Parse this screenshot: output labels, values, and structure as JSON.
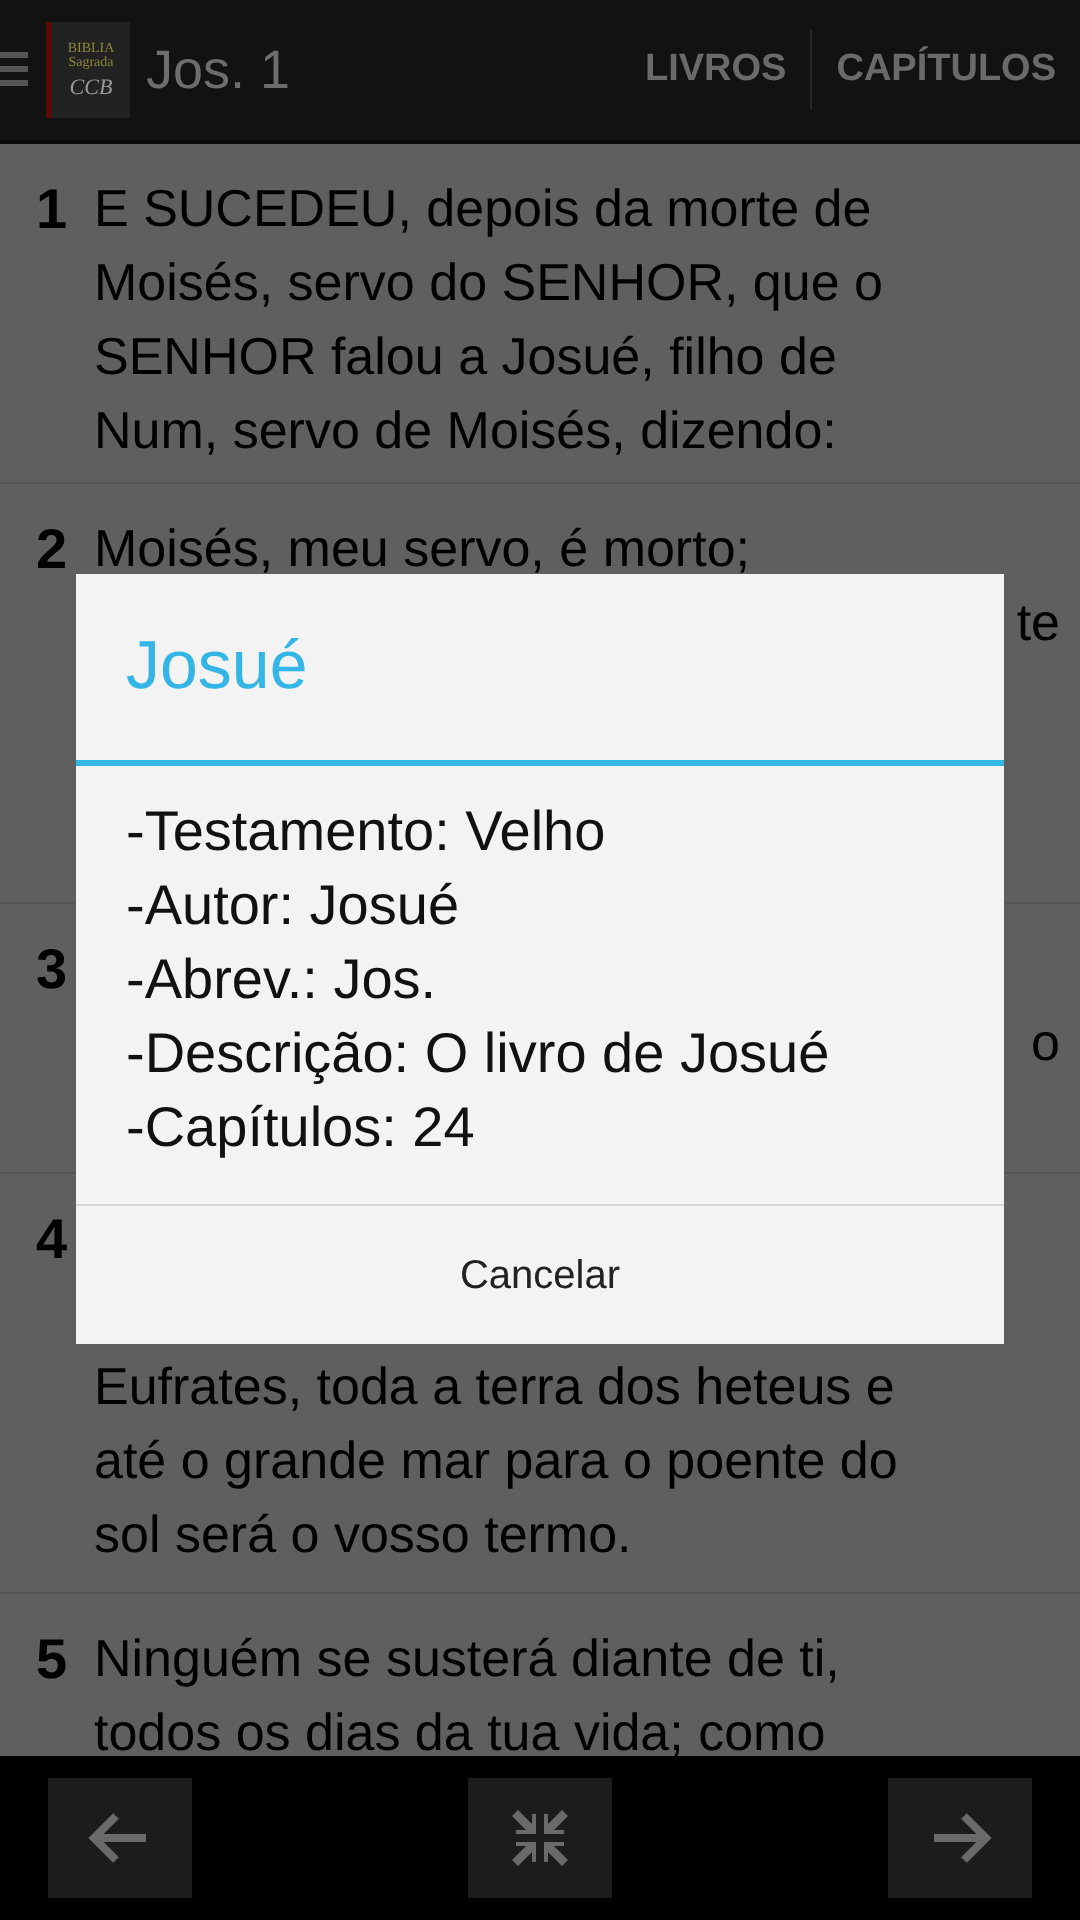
{
  "app_bar": {
    "logo": {
      "line_1": "BIBLIA",
      "line_2": "Sagrada",
      "line_3": "CCB"
    },
    "title": "Jos. 1",
    "actions": [
      "LIVROS",
      "CAPÍTULOS"
    ]
  },
  "verses": [
    {
      "number": "1",
      "lines": [
        {
          "kind": "text",
          "text": "E SUCEDEU, depois da morte de"
        },
        {
          "kind": "text",
          "text": "Moisés, servo do SENHOR, que o"
        },
        {
          "kind": "text",
          "text": "SENHOR falou a Josué, filho de"
        },
        {
          "kind": "text",
          "text": "Num, servo de Moisés, dizendo:"
        }
      ]
    },
    {
      "number": "2",
      "lines": [
        {
          "kind": "text",
          "text": "Moisés, meu servo, é morto;"
        },
        {
          "kind": "end",
          "text": "te"
        }
      ]
    },
    {
      "number": "3",
      "lines": [
        {
          "kind": "gap"
        },
        {
          "kind": "end",
          "text": "o"
        }
      ]
    },
    {
      "number": "4",
      "lines": [
        {
          "kind": "gap"
        },
        {
          "kind": "gap"
        },
        {
          "kind": "text",
          "text": "Eufrates, toda a terra dos heteus e"
        },
        {
          "kind": "text",
          "text": "até o grande mar para o poente do"
        },
        {
          "kind": "text",
          "text": "sol será o vosso termo."
        }
      ]
    },
    {
      "number": "5",
      "lines": [
        {
          "kind": "text",
          "text": "Ninguém se susterá diante de ti,"
        },
        {
          "kind": "text",
          "text": "todos os dias da tua vida; como"
        }
      ]
    }
  ],
  "dialog": {
    "title": "Josué",
    "items": [
      "-Testamento: Velho",
      "-Autor: Josué",
      "-Abrev.: Jos.",
      "-Descrição: O livro de Josué",
      "-Capítulos: 24"
    ],
    "button": "Cancelar"
  },
  "bottom_bar": [
    {
      "kind": "previous"
    },
    {
      "kind": "collapse"
    },
    {
      "kind": "next"
    }
  ]
}
